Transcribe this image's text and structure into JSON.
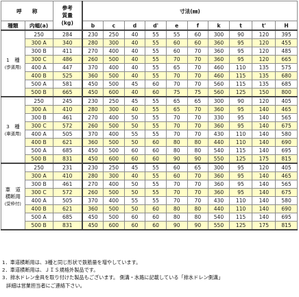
{
  "header": {
    "yobi": "呼　　称",
    "weight_top": "参考",
    "weight_mid": "質量",
    "weight_unit": "(kg)",
    "dims_title": "寸法(㎜)",
    "type": "種類",
    "width": "内幅(a)",
    "cols": [
      "b",
      "c",
      "d",
      "d'",
      "e",
      "f",
      "k",
      "t",
      "t'",
      "H"
    ]
  },
  "groups": [
    {
      "lines": [
        "1　種",
        "(歩道用)"
      ],
      "rows": [
        [
          "250",
          "284",
          "230",
          "250",
          "40",
          "55",
          "55",
          "60",
          "300",
          "90",
          "120",
          "395"
        ],
        [
          "300 A",
          "340",
          "280",
          "300",
          "40",
          "55",
          "60",
          "60",
          "360",
          "95",
          "120",
          "455"
        ],
        [
          "300 B",
          "411",
          "270",
          "400",
          "40",
          "55",
          "60",
          "70",
          "360",
          "95",
          "120",
          "485"
        ],
        [
          "300 C",
          "486",
          "260",
          "500",
          "40",
          "55",
          "70",
          "70",
          "360",
          "95",
          "120",
          "665"
        ],
        [
          "400 A",
          "447",
          "370",
          "400",
          "40",
          "55",
          "65",
          "70",
          "460",
          "110",
          "135",
          "575"
        ],
        [
          "400 B",
          "525",
          "360",
          "500",
          "40",
          "55",
          "70",
          "70",
          "460",
          "115",
          "135",
          "680"
        ],
        [
          "500 A",
          "581",
          "450",
          "500",
          "45",
          "60",
          "70",
          "70",
          "560",
          "115",
          "135",
          "685"
        ],
        [
          "500 B",
          "665",
          "450",
          "600",
          "40",
          "60",
          "75",
          "75",
          "560",
          "125",
          "150",
          "800"
        ]
      ]
    },
    {
      "lines": [
        "3　種",
        "(車道用)"
      ],
      "rows": [
        [
          "250",
          "245",
          "230",
          "250",
          "45",
          "55",
          "65",
          "65",
          "300",
          "90",
          "120",
          "405"
        ],
        [
          "300 A",
          "410",
          "280",
          "300",
          "40",
          "55",
          "65",
          "70",
          "360",
          "95",
          "140",
          "465"
        ],
        [
          "300 B",
          "461",
          "270",
          "400",
          "50",
          "55",
          "70",
          "70",
          "330",
          "95",
          "140",
          "565"
        ],
        [
          "300 C",
          "572",
          "260",
          "500",
          "50",
          "55",
          "70",
          "70",
          "360",
          "95",
          "140",
          "675"
        ],
        [
          "400 A",
          "505",
          "370",
          "400",
          "55",
          "55",
          "70",
          "70",
          "430",
          "110",
          "140",
          "580"
        ],
        [
          "400 B",
          "621",
          "360",
          "500",
          "50",
          "60",
          "80",
          "80",
          "440",
          "110",
          "140",
          "690"
        ],
        [
          "500 A",
          "685",
          "450",
          "500",
          "60",
          "60",
          "80",
          "80",
          "540",
          "115",
          "140",
          "695"
        ],
        [
          "500 B",
          "831",
          "450",
          "600",
          "60",
          "60",
          "90",
          "90",
          "550",
          "125",
          "175",
          "815"
        ]
      ]
    },
    {
      "lines": [
        "車　道",
        "横断用",
        "(受枠付)"
      ],
      "rows": [
        [
          "250",
          "231",
          "230",
          "250",
          "45",
          "55",
          "60",
          "65",
          "300",
          "95",
          "120",
          "405"
        ],
        [
          "300 A",
          "410",
          "280",
          "300",
          "40",
          "55",
          "60",
          "70",
          "360",
          "95",
          "140",
          "465"
        ],
        [
          "300 B",
          "461",
          "270",
          "400",
          "50",
          "55",
          "70",
          "70",
          "360",
          "95",
          "140",
          "565"
        ],
        [
          "300 C",
          "572",
          "260",
          "500",
          "50",
          "55",
          "70",
          "70",
          "360",
          "95",
          "140",
          "675"
        ],
        [
          "400 A",
          "505",
          "370",
          "400",
          "55",
          "55",
          "70",
          "70",
          "430",
          "110",
          "140",
          "580"
        ],
        [
          "400 B",
          "621",
          "360",
          "500",
          "50",
          "60",
          "80",
          "80",
          "440",
          "110",
          "140",
          "690"
        ],
        [
          "500 A",
          "685",
          "450",
          "500",
          "60",
          "60",
          "80",
          "80",
          "540",
          "115",
          "140",
          "695"
        ],
        [
          "500 B",
          "831",
          "450",
          "600",
          "60",
          "60",
          "90",
          "90",
          "550",
          "125",
          "175",
          "815"
        ]
      ]
    }
  ],
  "notes": [
    "1．車道横断用は、3種と同じ形状で鉄筋量を増やしています。",
    "2．車道横断用は、ＪＩＳ規格外製品です。",
    "3．排水ドレン金具を取り付けた製品もございます。 側溝・水路に記載している「排水ドレン側溝」",
    "詳細は営業担当者にご連絡下さい。"
  ]
}
